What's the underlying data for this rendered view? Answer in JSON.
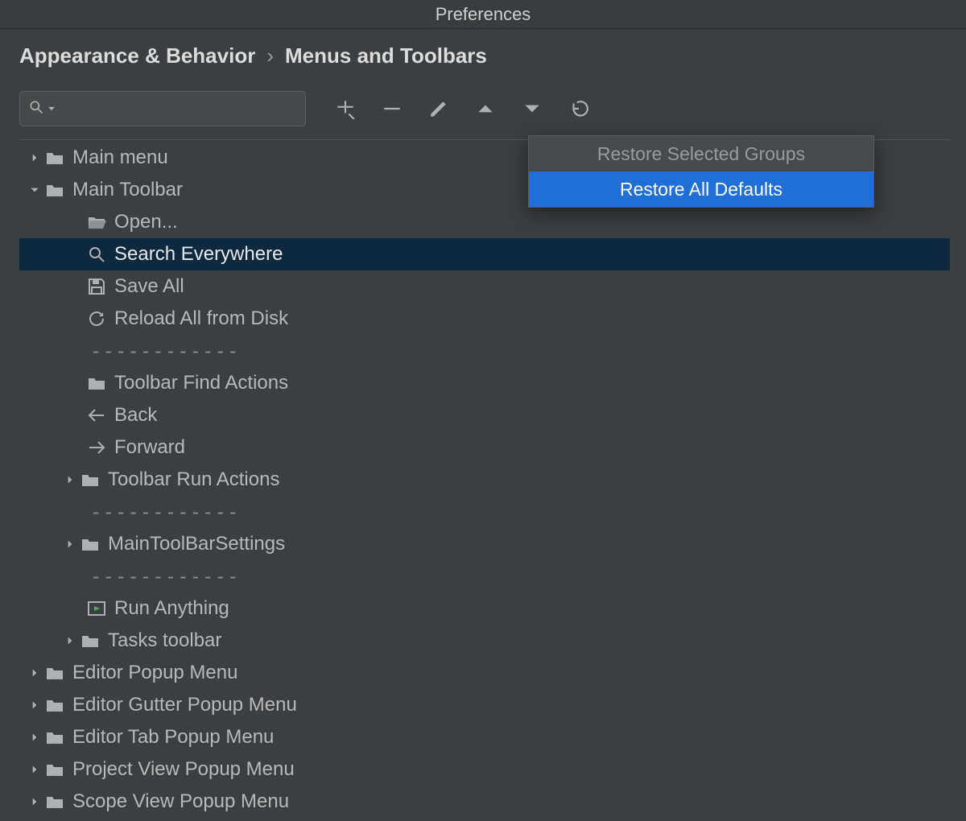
{
  "window": {
    "title": "Preferences"
  },
  "breadcrumb": {
    "root": "Appearance & Behavior",
    "sep": "›",
    "leaf": "Menus and Toolbars"
  },
  "search": {
    "placeholder": ""
  },
  "popup": {
    "restore_selected": "Restore Selected Groups",
    "restore_all": "Restore All Defaults"
  },
  "sep_text": "------------",
  "tree": {
    "main_menu": "Main menu",
    "main_toolbar": "Main Toolbar",
    "open": "Open...",
    "search_everywhere": "Search Everywhere",
    "save_all": "Save All",
    "reload_all": "Reload All from Disk",
    "toolbar_find_actions": "Toolbar Find Actions",
    "back": "Back",
    "forward": "Forward",
    "toolbar_run_actions": "Toolbar Run Actions",
    "main_toolbar_settings": "MainToolBarSettings",
    "run_anything": "Run Anything",
    "tasks_toolbar": "Tasks toolbar",
    "editor_popup": "Editor Popup Menu",
    "editor_gutter_popup": "Editor Gutter Popup Menu",
    "editor_tab_popup": "Editor Tab Popup Menu",
    "project_view_popup": "Project View Popup Menu",
    "scope_view_popup": "Scope View Popup Menu"
  }
}
